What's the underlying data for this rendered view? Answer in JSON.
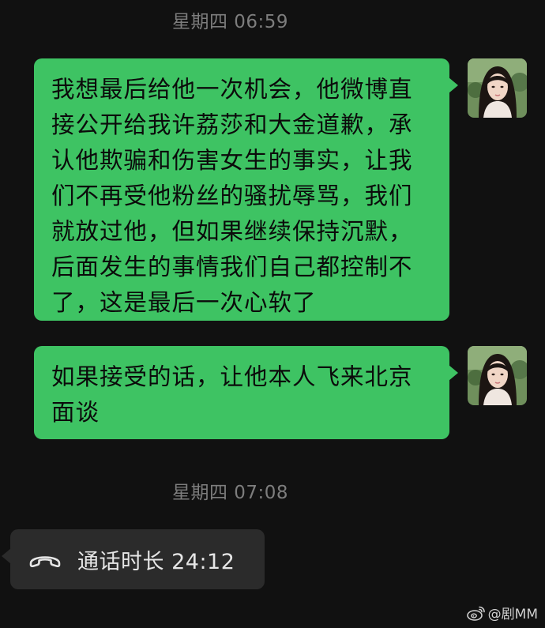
{
  "chat": {
    "timestamp_1": "星期四 06:59",
    "message_1": "我想最后给他一次机会，他微博直接公开给我许荔莎和大金道歉，承认他欺骗和伤害女生的事实，让我们不再受他粉丝的骚扰辱骂，我们就放过他，但如果继续保持沉默，后面发生的事情我们自己都控制不了，这是最后一次心软了",
    "message_2": "如果接受的话，让他本人飞来北京面谈",
    "timestamp_2": "星期四 07:08",
    "call_duration_text": "通话时长 24:12"
  },
  "watermark": {
    "text": "@剧MM",
    "icon": "weibo-logo"
  },
  "icons": {
    "call": "phone-hangup-icon"
  },
  "colors": {
    "background": "#111111",
    "sent_bubble": "#3ec363",
    "received_bubble": "#2b2b2b",
    "timestamp_text": "#7d7d7d"
  }
}
